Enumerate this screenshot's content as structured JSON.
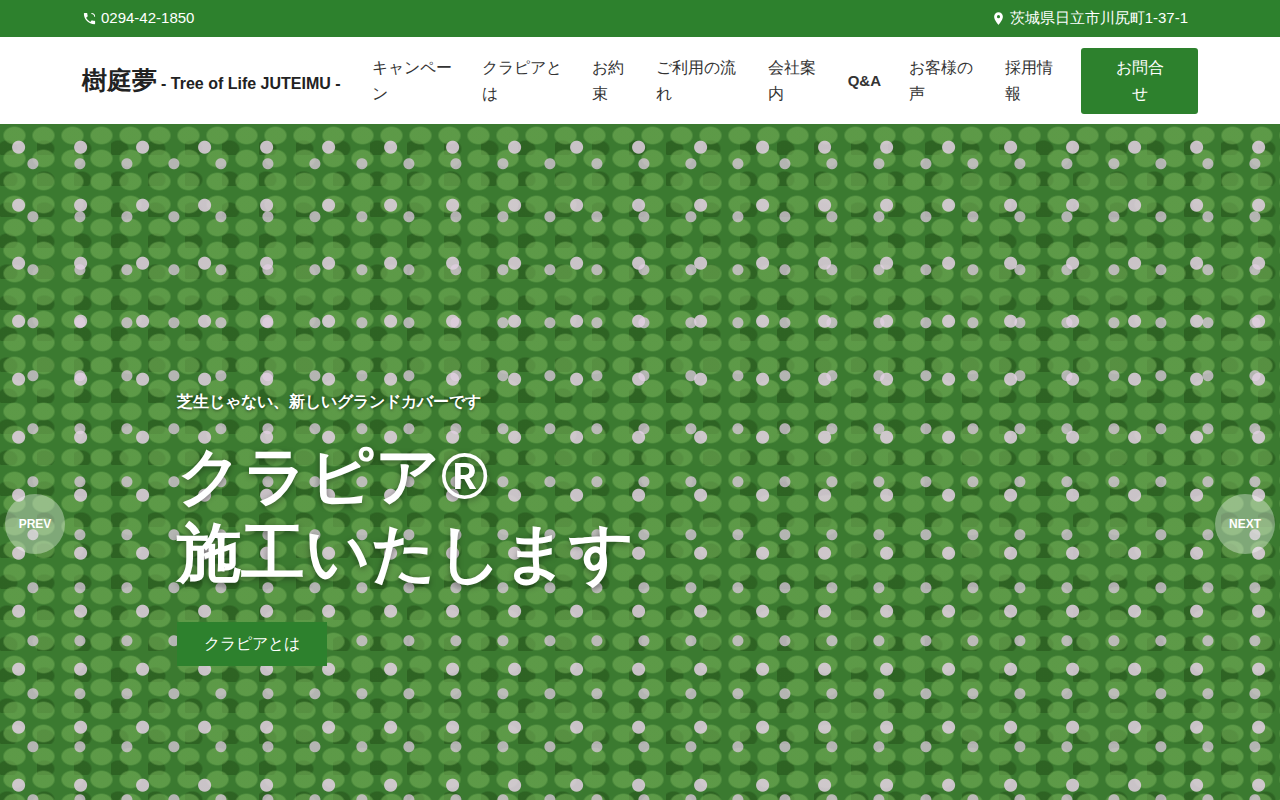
{
  "topbar": {
    "phone": "0294-42-1850",
    "address": "茨城県日立市川尻町1-37-1"
  },
  "logo": {
    "name": "樹庭夢",
    "tagline": "- Tree of Life JUTEIMU -"
  },
  "nav": {
    "items": [
      {
        "label": "キャンペーン"
      },
      {
        "label": "クラピアとは"
      },
      {
        "label": "お約束"
      },
      {
        "label": "ご利用の流れ"
      },
      {
        "label": "会社案内"
      },
      {
        "label": "Q&A"
      },
      {
        "label": "お客様の声"
      },
      {
        "label": "採用情報"
      }
    ],
    "cta": "お問合せ"
  },
  "hero": {
    "subtitle": "芝生じゃない、新しいグランドカバーです",
    "title_lines": [
      "クラピア®",
      "施工いたします"
    ],
    "button": "クラピアとは",
    "prev": "PREV",
    "next": "NEXT"
  }
}
